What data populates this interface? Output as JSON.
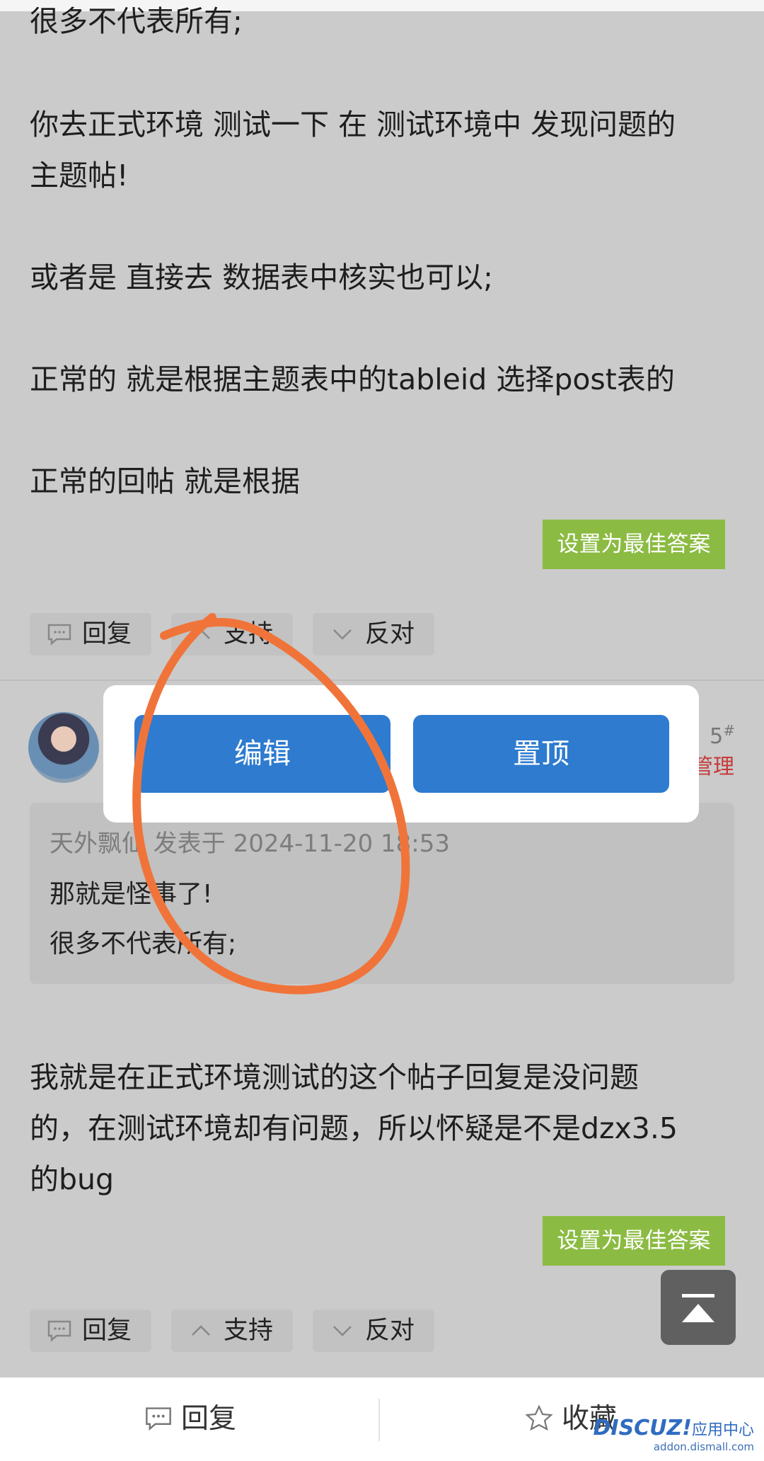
{
  "post1": {
    "lines": [
      "很多不代表所有;",
      "你去正式环境 测试一下  在 测试环境中 发现问题的",
      "主题帖!",
      "或者是 直接去 数据表中核实也可以;",
      "正常的  就是根据主题表中的tableid 选择post表的",
      "正常的回帖 就是根据"
    ],
    "best_answer_label": "设置为最佳答案",
    "actions": {
      "reply": "回复",
      "support": "支持",
      "oppose": "反对"
    }
  },
  "post2": {
    "floor": "5",
    "floor_mark": "#",
    "role": "管理",
    "quote": {
      "meta": "天外飘仙 发表于 2024-11-20 18:53",
      "line1": "那就是怪事了!",
      "line2": "很多不代表所有;"
    },
    "lines": [
      "我就是在正式环境测试的这个帖子回复是没问题",
      "的，在测试环境却有问题，所以怀疑是不是dzx3.5",
      "的bug"
    ],
    "best_answer_label": "设置为最佳答案",
    "actions": {
      "reply": "回复",
      "support": "支持",
      "oppose": "反对"
    }
  },
  "modal": {
    "edit_label": "编辑",
    "pin_label": "置顶"
  },
  "bottom_bar": {
    "reply_label": "回复",
    "favorite_label": "收藏"
  },
  "watermark": {
    "brand": "DISCUZ!",
    "brand_suffix": "应用中心",
    "url": "addon.dismall.com"
  },
  "icons": {
    "reply": "comment-icon",
    "support": "chevron-up-icon",
    "oppose": "chevron-down-icon",
    "back_to_top": "arrow-up-to-top-icon",
    "favorite": "star-icon"
  },
  "colors": {
    "overlay": "#cbcbcb",
    "best_answer": "#8bbb42",
    "modal_button": "#2e7bd0",
    "role": "#c73a3a",
    "annotation": "#f0743a"
  }
}
